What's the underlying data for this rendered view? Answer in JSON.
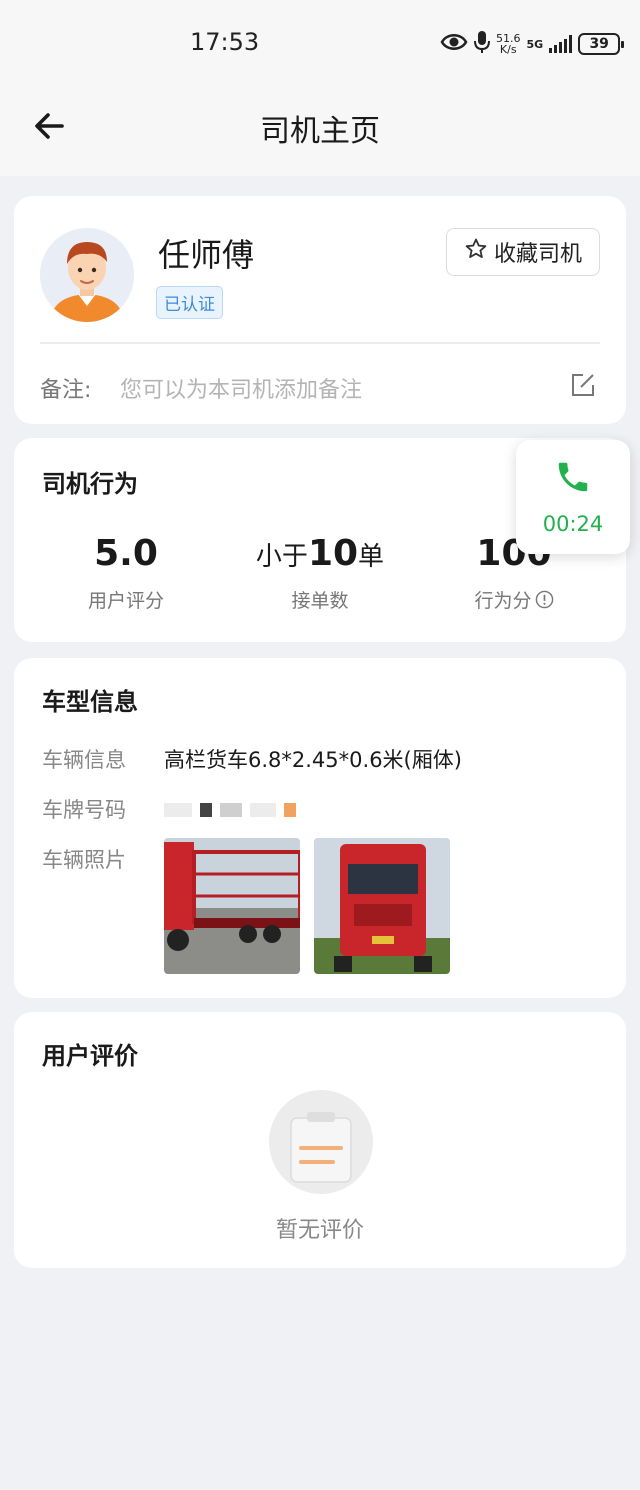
{
  "status_bar": {
    "time": "17:53",
    "net_speed_value": "51.6",
    "net_speed_unit": "K/s",
    "network": "5G",
    "battery": "39"
  },
  "nav": {
    "title": "司机主页"
  },
  "driver": {
    "name": "任师傅",
    "verified_badge": "已认证",
    "favorite_label": "收藏司机",
    "note_label": "备注:",
    "note_placeholder": "您可以为本司机添加备注"
  },
  "behavior": {
    "title": "司机行为",
    "stats": [
      {
        "prefix": "",
        "value": "5.0",
        "suffix": "",
        "label": "用户评分"
      },
      {
        "prefix": "小于",
        "value": "10",
        "suffix": "单",
        "label": "接单数"
      },
      {
        "prefix": "",
        "value": "100",
        "suffix": "",
        "label": "行为分"
      }
    ]
  },
  "call": {
    "duration": "00:24"
  },
  "vehicle": {
    "title": "车型信息",
    "info_label": "车辆信息",
    "info_value": "高栏货车6.8*2.45*0.6米(厢体)",
    "plate_label": "车牌号码",
    "photos_label": "车辆照片"
  },
  "reviews": {
    "title": "用户评价",
    "empty_text": "暂无评价"
  },
  "colors": {
    "accent_green": "#22b14c",
    "verified_blue": "#3d8bd9",
    "avatar_orange": "#f08a2c",
    "truck_red": "#c8262b"
  }
}
